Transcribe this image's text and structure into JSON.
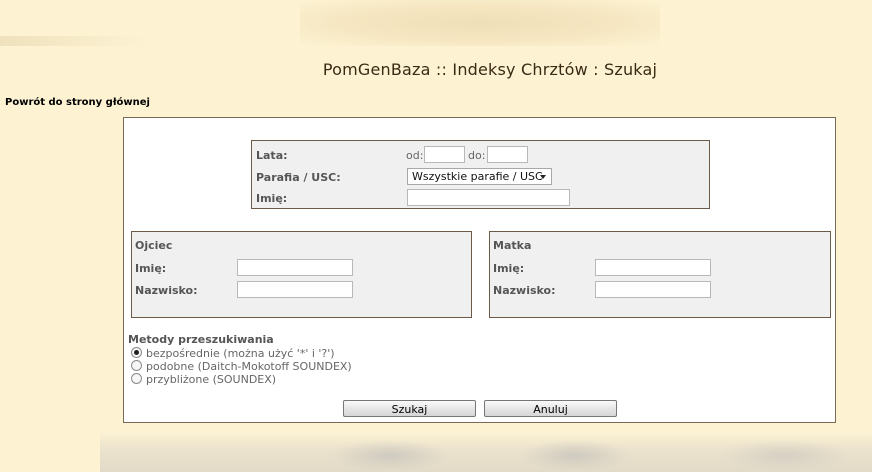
{
  "page": {
    "title": "PomGenBaza :: Indeksy Chrztów : Szukaj",
    "back_link": "Powrót do strony głównej"
  },
  "search": {
    "years": {
      "label": "Lata:",
      "from_label": "od:",
      "from_value": "",
      "to_label": "do:",
      "to_value": ""
    },
    "parish": {
      "label": "Parafia / USC:",
      "selected": "Wszystkie parafie / USC"
    },
    "name": {
      "label": "Imię:",
      "value": ""
    }
  },
  "father": {
    "title": "Ojciec",
    "first_name_label": "Imię:",
    "first_name_value": "",
    "surname_label": "Nazwisko:",
    "surname_value": ""
  },
  "mother": {
    "title": "Matka",
    "first_name_label": "Imię:",
    "first_name_value": "",
    "surname_label": "Nazwisko:",
    "surname_value": ""
  },
  "methods": {
    "title": "Metody przeszukiwania",
    "options": [
      {
        "label": "bezpośrednie (można użyć '*' i '?')",
        "checked": true
      },
      {
        "label": "podobne (Daitch-Mokotoff SOUNDEX)",
        "checked": false
      },
      {
        "label": "przybliżone (SOUNDEX)",
        "checked": false
      }
    ]
  },
  "buttons": {
    "search": "Szukaj",
    "cancel": "Anuluj"
  }
}
